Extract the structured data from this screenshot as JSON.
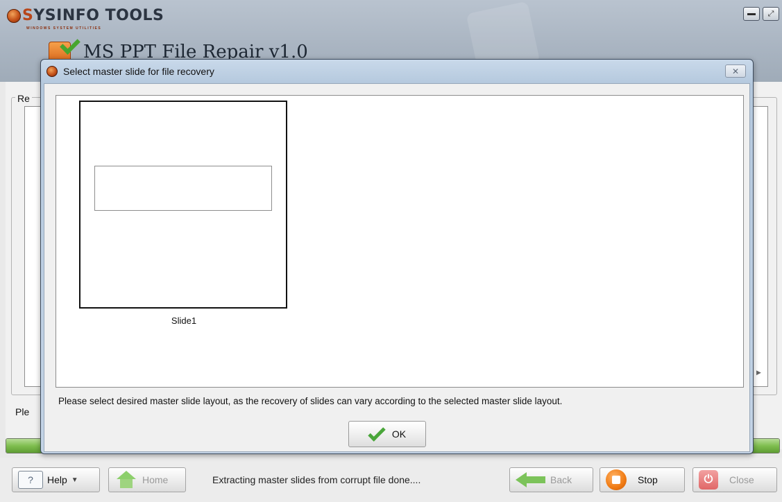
{
  "app": {
    "brand_name_first": "S",
    "brand_name_rest": "YSINFO TOOLS",
    "brand_tagline": "WINDOWS SYSTEM UTILITIES",
    "product_title": "MS PPT File Repair v1.0",
    "background_group_label": "Re",
    "background_status_label": "Ple",
    "progress_percent": 100,
    "accent_color": "#7fbe4f"
  },
  "dialog": {
    "title": "Select master slide for file recovery",
    "close_glyph": "✕",
    "slides": [
      {
        "label": "Slide1"
      }
    ],
    "message": "Please select desired master slide layout, as the recovery of slides can vary according to the selected master slide layout.",
    "ok_label": "OK"
  },
  "toolbar": {
    "help_label": "Help",
    "home_label": "Home",
    "status_text": "Extracting master slides from corrupt file done....",
    "back_label": "Back",
    "stop_label": "Stop",
    "close_label": "Close"
  },
  "icons": {
    "help": "help-icon",
    "home": "home-icon",
    "back": "back-arrow-icon",
    "stop": "stop-icon",
    "close": "power-icon",
    "ok": "checkmark-icon"
  }
}
